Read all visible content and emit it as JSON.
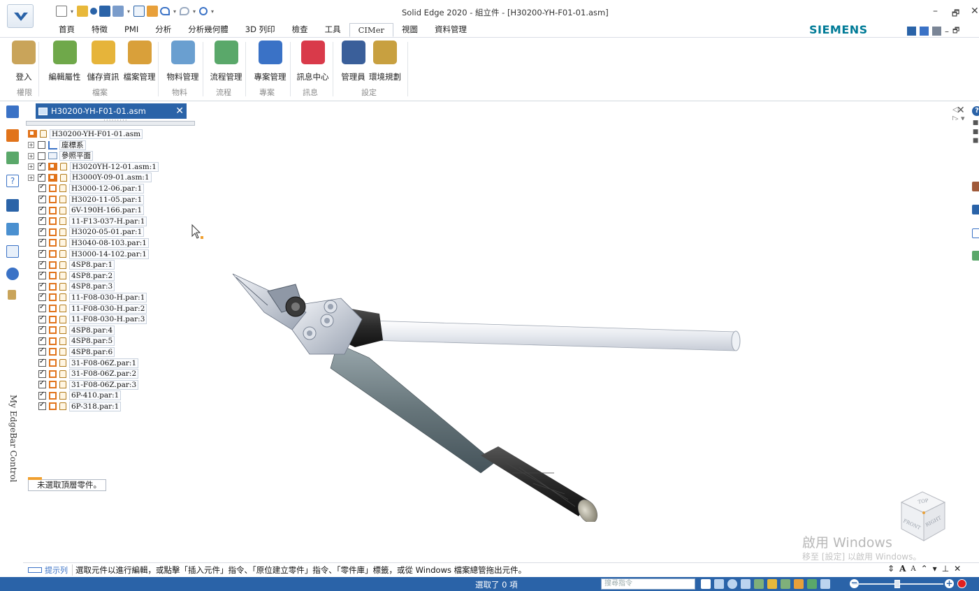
{
  "window": {
    "title": "Solid Edge 2020 - 組立件 - [H30200-YH-F01-01.asm]",
    "brand": "SIEMENS",
    "controls": [
      "–",
      "🗗",
      "✕"
    ]
  },
  "ribbon_tabs": [
    "首頁",
    "特徵",
    "PMI",
    "分析",
    "分析幾何體",
    "3D 列印",
    "檢查",
    "工具",
    "CIMer",
    "視圖",
    "資料管理"
  ],
  "active_tab": "CIMer",
  "ribbon": {
    "buttons": [
      {
        "label": "登入",
        "icon": "key-icon",
        "color": "#c9a45a"
      },
      {
        "label": "編輯屬性",
        "icon": "edit-properties-icon",
        "color": "#6fa84a"
      },
      {
        "label": "儲存資訊",
        "icon": "save-info-icon",
        "color": "#e6b43a"
      },
      {
        "label": "檔案管理",
        "icon": "file-management-icon",
        "color": "#d9a03a"
      },
      {
        "label": "物料管理",
        "icon": "material-gear-icon",
        "color": "#6a9fd0"
      },
      {
        "label": "流程管理",
        "icon": "process-flow-icon",
        "color": "#5aa86a"
      },
      {
        "label": "專案管理",
        "icon": "project-gantt-icon",
        "color": "#3a72c6"
      },
      {
        "label": "訊息中心",
        "icon": "message-mail-icon",
        "color": "#d93a4a"
      },
      {
        "label": "管理員",
        "icon": "admin-user-icon",
        "color": "#3a5f9a"
      },
      {
        "label": "環境規劃",
        "icon": "environment-tools-icon",
        "color": "#c8a040"
      }
    ],
    "groups": [
      "權限",
      "檔案",
      "物料",
      "流程",
      "專案",
      "訊息",
      "設定"
    ]
  },
  "document_tab": {
    "label": "H30200-YH-F01-01.asm",
    "close": "✕"
  },
  "pathfinder": {
    "root": "H30200-YH-F01-01.asm",
    "items": [
      {
        "label": "座標系",
        "type": "coord",
        "expander": "+",
        "checked": false
      },
      {
        "label": "參照平面",
        "type": "plane",
        "expander": "+",
        "checked": false
      },
      {
        "label": "H3020YH-12-01.asm:1",
        "type": "asm",
        "expander": "+",
        "checked": true
      },
      {
        "label": "H3000Y-09-01.asm:1",
        "type": "asm",
        "expander": "+",
        "checked": true
      },
      {
        "label": "H3000-12-06.par:1",
        "type": "part",
        "checked": true
      },
      {
        "label": "H3020-11-05.par:1",
        "type": "part",
        "checked": true
      },
      {
        "label": "6V-190H-166.par:1",
        "type": "part",
        "checked": true
      },
      {
        "label": "11-F13-037-H.par:1",
        "type": "part",
        "checked": true
      },
      {
        "label": "H3020-05-01.par:1",
        "type": "part",
        "checked": true
      },
      {
        "label": "H3040-08-103.par:1",
        "type": "part",
        "checked": true
      },
      {
        "label": "H3000-14-102.par:1",
        "type": "part",
        "checked": true
      },
      {
        "label": "4SP8.par:1",
        "type": "part",
        "checked": true
      },
      {
        "label": "4SP8.par:2",
        "type": "part",
        "checked": true
      },
      {
        "label": "4SP8.par:3",
        "type": "part",
        "checked": true
      },
      {
        "label": "11-F08-030-H.par:1",
        "type": "part",
        "checked": true
      },
      {
        "label": "11-F08-030-H.par:2",
        "type": "part",
        "checked": true
      },
      {
        "label": "11-F08-030-H.par:3",
        "type": "part",
        "checked": true
      },
      {
        "label": "4SP8.par:4",
        "type": "part",
        "checked": true
      },
      {
        "label": "4SP8.par:5",
        "type": "part",
        "checked": true
      },
      {
        "label": "4SP8.par:6",
        "type": "part",
        "checked": true
      },
      {
        "label": "31-F08-06Z.par:1",
        "type": "part",
        "checked": true
      },
      {
        "label": "31-F08-06Z.par:2",
        "type": "part",
        "checked": true
      },
      {
        "label": "31-F08-06Z.par:3",
        "type": "part",
        "checked": true
      },
      {
        "label": "6P-410.par:1",
        "type": "part",
        "checked": true
      },
      {
        "label": "6P-318.par:1",
        "type": "part",
        "checked": true
      }
    ]
  },
  "selection_box": "未選取頂層零件。",
  "edgebar_label": "My EdgeBar Control",
  "viewcube": {
    "top": "TOP",
    "front": "FRONT",
    "right": "RIGHT"
  },
  "watermark": {
    "line1": "啟用 Windows",
    "line2": "移至 [設定] 以啟用 Windows。"
  },
  "prompt": {
    "label": "提示列",
    "text": "選取元件以進行編輯，或點擊「插入元件」指令、「原位建立零件」指令、「零件庫」標籤，或從 Windows 檔案總管拖出元件。"
  },
  "status": {
    "selection": "選取了 0 項",
    "search_placeholder": "搜尋指令",
    "zoom_fraction": 0.45
  }
}
